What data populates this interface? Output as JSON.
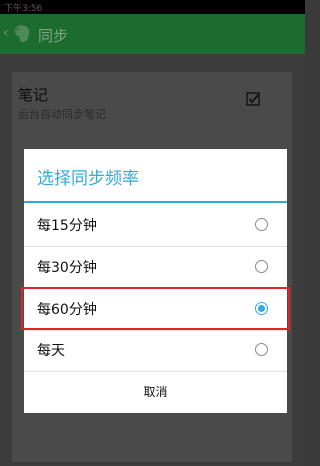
{
  "status_bar": {
    "time": "下午3:56"
  },
  "app_bar": {
    "back_glyph": "‹",
    "logo_icon": "evernote-elephant-icon",
    "title": "同步",
    "color": "#1d6b2e"
  },
  "background_setting": {
    "title": "笔记",
    "subtitle": "后台自动同步笔记",
    "checked": true
  },
  "dialog": {
    "title": "选择同步频率",
    "accent_color": "#33aadc",
    "highlight_color": "#e0242c",
    "options": [
      {
        "label": "每15分钟",
        "selected": false
      },
      {
        "label": "每30分钟",
        "selected": false
      },
      {
        "label": "每60分钟",
        "selected": true
      },
      {
        "label": "每天",
        "selected": false
      }
    ],
    "cancel_label": "取消"
  }
}
